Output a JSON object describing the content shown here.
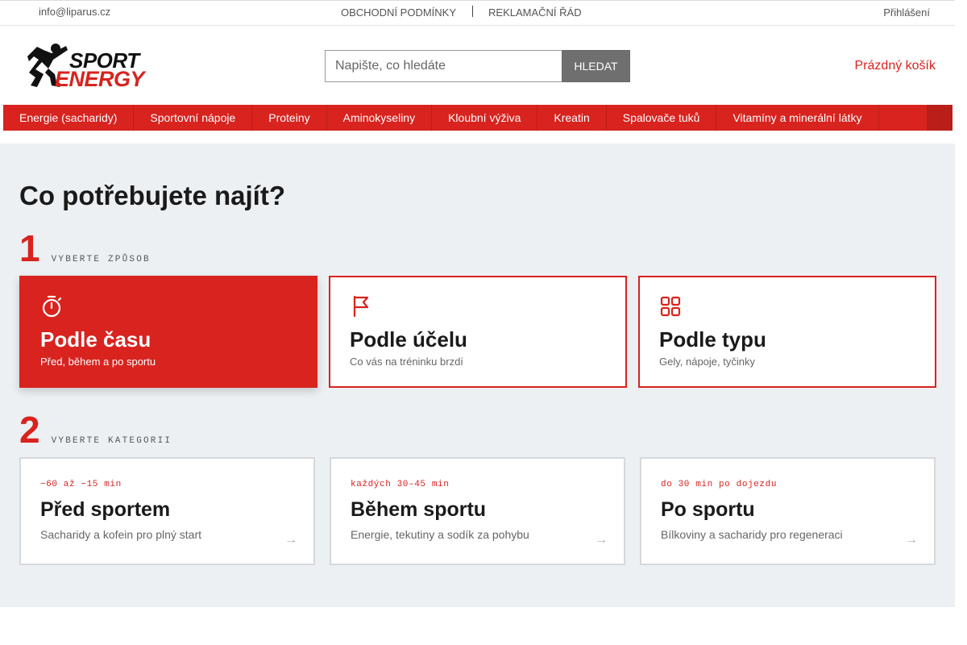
{
  "topbar": {
    "email": "info@liparus.cz",
    "links": [
      "OBCHODNÍ PODMÍNKY",
      "REKLAMAČNÍ ŘÁD"
    ],
    "login": "Přihlášení"
  },
  "header": {
    "logo_word1": "SPORT",
    "logo_word2": "ENERGY",
    "search_placeholder": "Napište, co hledáte",
    "search_button": "HLEDAT",
    "cart": "Prázdný košík"
  },
  "nav": {
    "items": [
      "Energie (sacharidy)",
      "Sportovní nápoje",
      "Proteiny",
      "Aminokyseliny",
      "Kloubní výživa",
      "Kreatin",
      "Spalovače tuků",
      "Vitamíny a minerální látky"
    ]
  },
  "main": {
    "title": "Co potřebujete najít?",
    "step1": {
      "number": "1",
      "label": "VYBERTE ZPŮSOB"
    },
    "methods": [
      {
        "icon": "stopwatch-icon",
        "title": "Podle času",
        "subtitle": "Před, během a po sportu",
        "active": true
      },
      {
        "icon": "flag-icon",
        "title": "Podle účelu",
        "subtitle": "Co vás na tréninku brzdí",
        "active": false
      },
      {
        "icon": "grid-icon",
        "title": "Podle typu",
        "subtitle": "Gely, nápoje, tyčinky",
        "active": false
      }
    ],
    "step2": {
      "number": "2",
      "label": "VYBERTE KATEGORII"
    },
    "categories": [
      {
        "time": "−60 až −15 min",
        "title": "Před sportem",
        "subtitle": "Sacharidy a kofein pro plný start",
        "arrow": "→"
      },
      {
        "time": "každých 30–45 min",
        "title": "Během sportu",
        "subtitle": "Energie, tekutiny a sodík za pohybu",
        "arrow": "→"
      },
      {
        "time": "do 30 min po dojezdu",
        "title": "Po sportu",
        "subtitle": "Bílkoviny a sacharidy pro regeneraci",
        "arrow": "→"
      }
    ]
  },
  "colors": {
    "accent": "#d8231e",
    "background": "#edf0f3",
    "search_button": "#6f6f6f"
  }
}
